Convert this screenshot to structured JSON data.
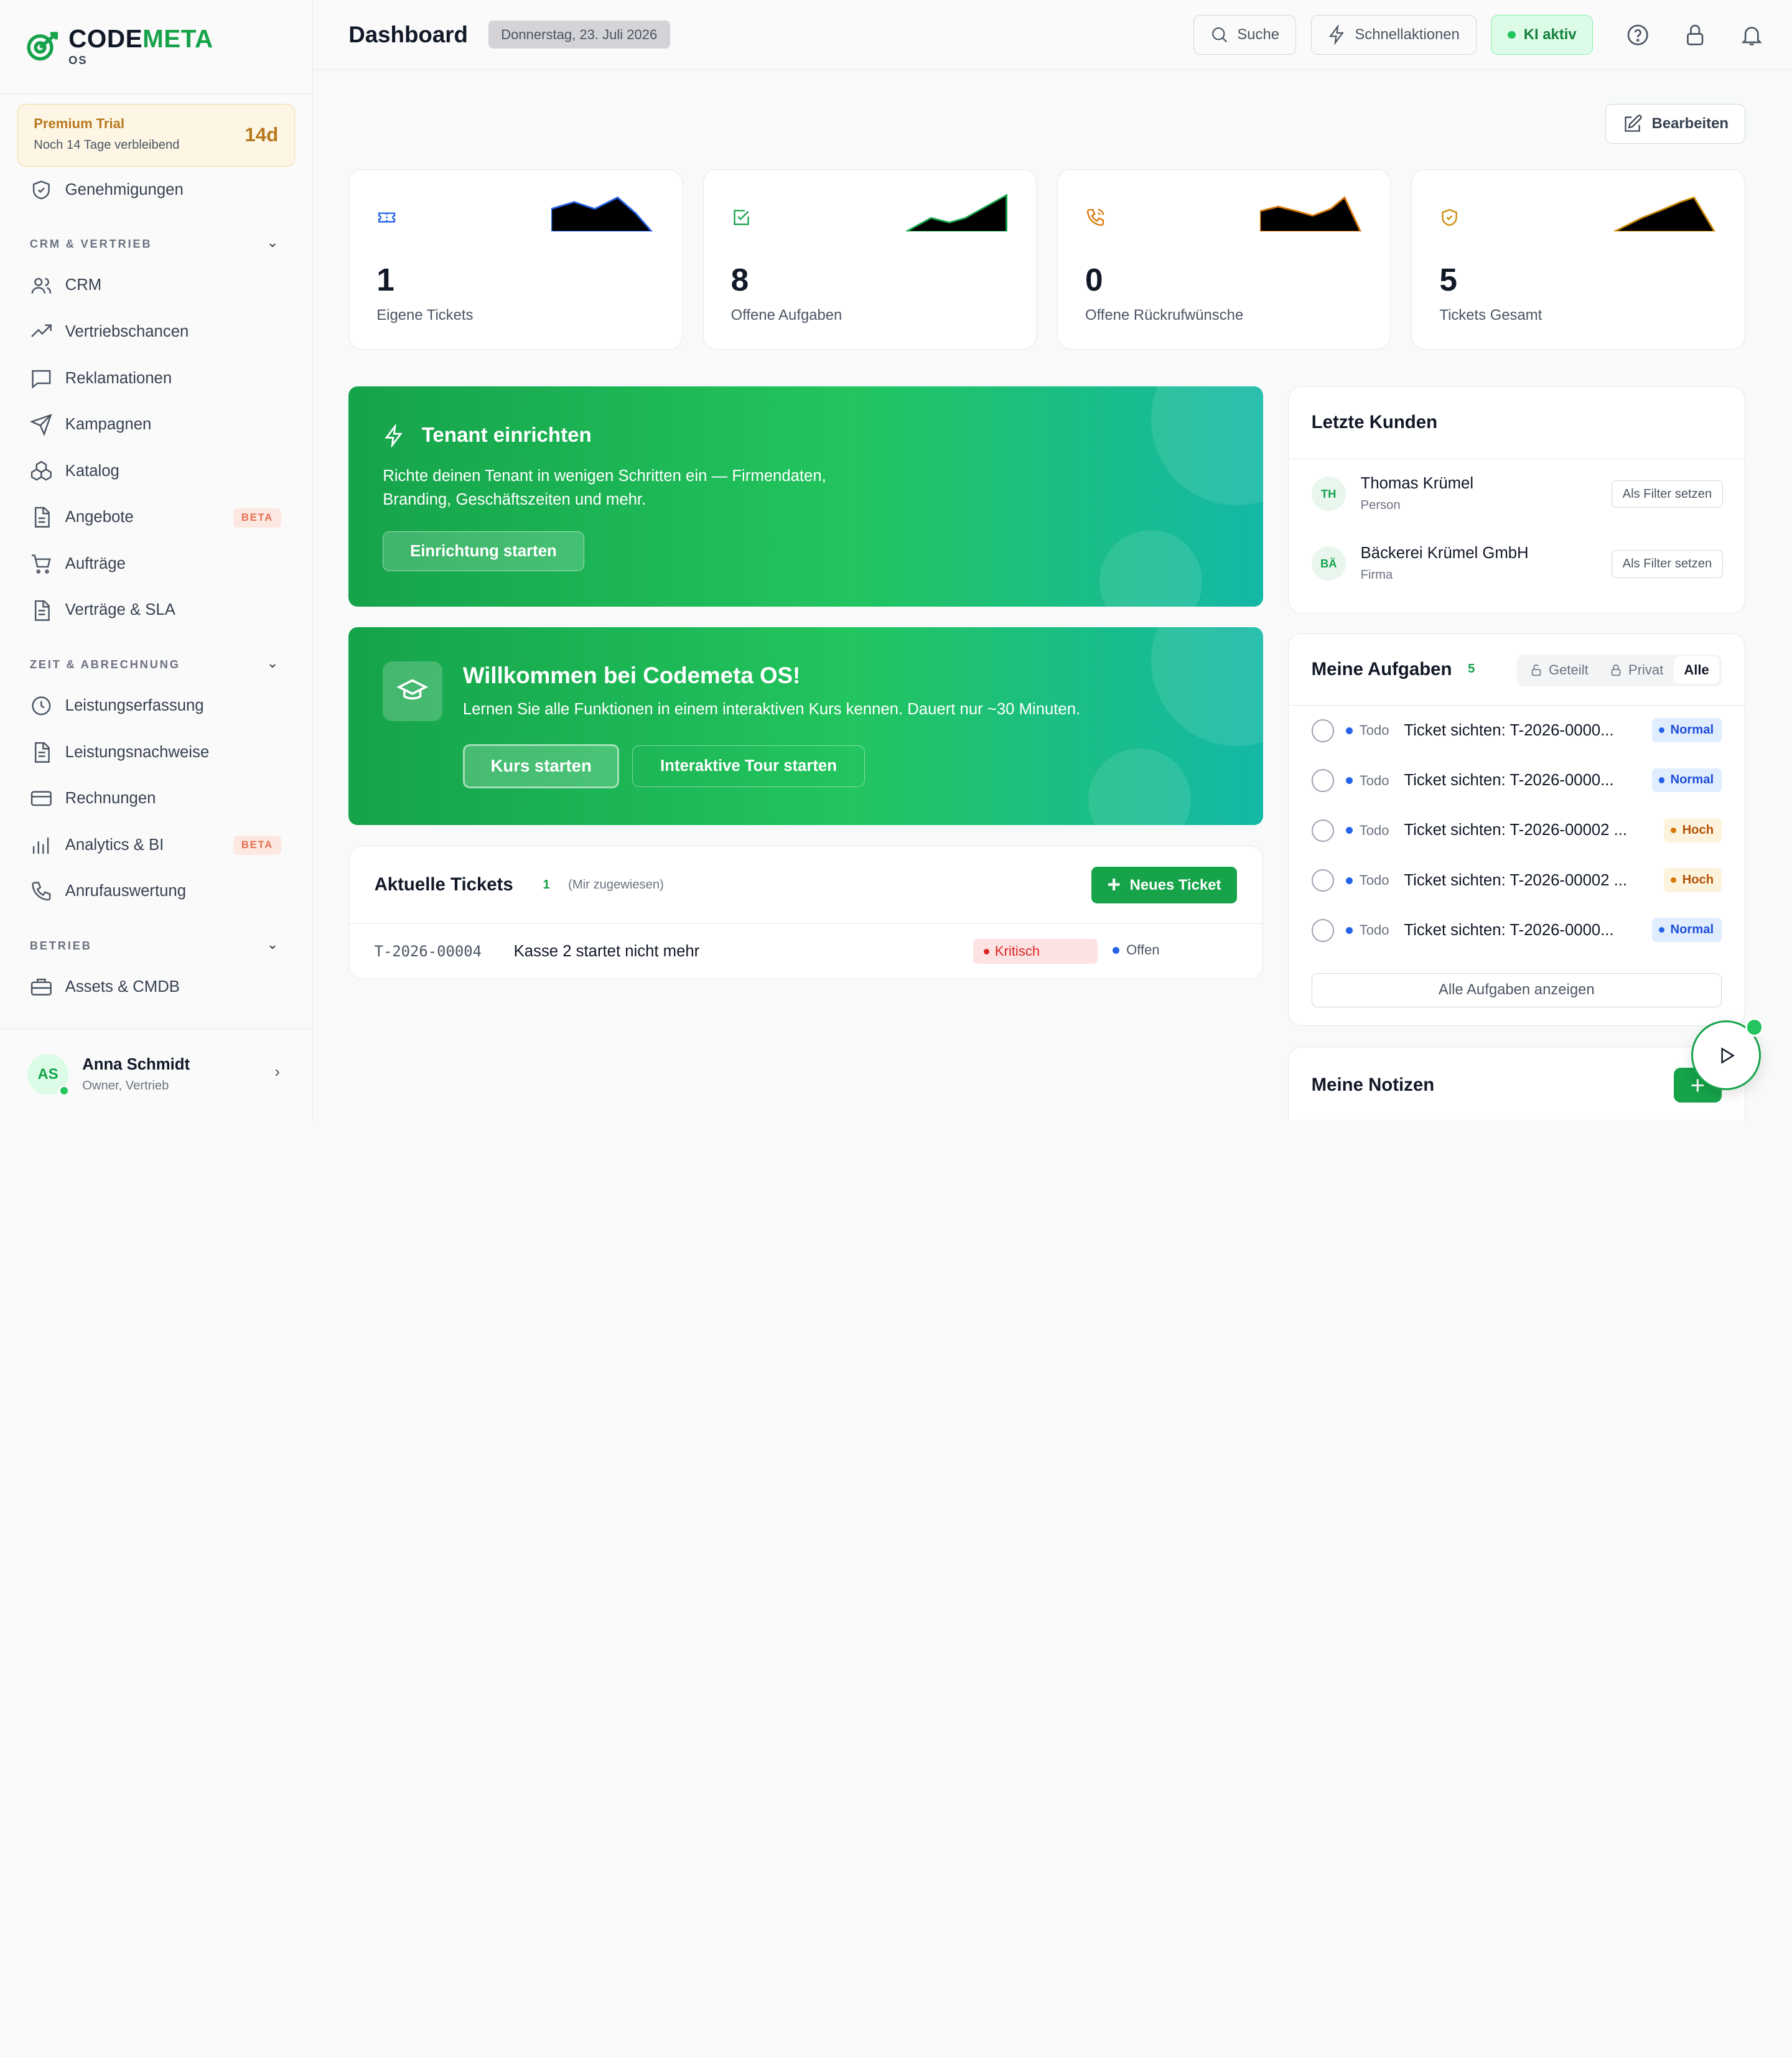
{
  "brand": {
    "name_part1": "CODE",
    "name_part2": "META",
    "sub": "OS"
  },
  "trial": {
    "title": "Premium Trial",
    "subtitle": "Noch 14 Tage verbleibend",
    "days": "14d"
  },
  "sidebar": {
    "top_item": "Genehmigungen",
    "sections": [
      {
        "label": "CRM & VERTRIEB",
        "items": [
          {
            "label": "CRM",
            "icon": "users-icon"
          },
          {
            "label": "Vertriebschancen",
            "icon": "trending-up-icon"
          },
          {
            "label": "Reklamationen",
            "icon": "message-icon"
          },
          {
            "label": "Kampagnen",
            "icon": "send-icon"
          },
          {
            "label": "Katalog",
            "icon": "boxes-icon"
          },
          {
            "label": "Angebote",
            "icon": "file-icon",
            "badge": "BETA"
          },
          {
            "label": "Aufträge",
            "icon": "cart-icon"
          },
          {
            "label": "Verträge & SLA",
            "icon": "file-text-icon"
          }
        ]
      },
      {
        "label": "ZEIT & ABRECHNUNG",
        "items": [
          {
            "label": "Leistungserfassung",
            "icon": "clock-icon"
          },
          {
            "label": "Leistungsnachweise",
            "icon": "file-text-icon"
          },
          {
            "label": "Rechnungen",
            "icon": "credit-card-icon"
          },
          {
            "label": "Analytics & BI",
            "icon": "bar-chart-icon",
            "badge": "BETA"
          },
          {
            "label": "Anrufauswertung",
            "icon": "phone-icon"
          }
        ]
      },
      {
        "label": "BETRIEB",
        "items": [
          {
            "label": "Assets & CMDB",
            "icon": "briefcase-icon"
          }
        ]
      }
    ]
  },
  "user": {
    "initials": "AS",
    "name": "Anna Schmidt",
    "role": "Owner, Vertrieb"
  },
  "header": {
    "title": "Dashboard",
    "date": "Donnerstag, 23. Juli 2026",
    "search": "Suche",
    "quick_actions": "Schnellaktionen",
    "ai_status": "KI aktiv",
    "edit": "Bearbeiten"
  },
  "kpis": [
    {
      "value": "1",
      "label": "Eigene Tickets",
      "color": "#2563eb",
      "icon": "ticket-icon"
    },
    {
      "value": "8",
      "label": "Offene Aufgaben",
      "color": "#16a34a",
      "icon": "check-square-icon"
    },
    {
      "value": "0",
      "label": "Offene Rückrufwünsche",
      "color": "#d97706",
      "icon": "phone-call-icon"
    },
    {
      "value": "5",
      "label": "Tickets Gesamt",
      "color": "#ca8a04",
      "icon": "shield-check-icon"
    }
  ],
  "setup_banner": {
    "title": "Tenant einrichten",
    "description": "Richte deinen Tenant in wenigen Schritten ein — Firmendaten, Branding, Geschäftszeiten und mehr.",
    "button": "Einrichtung starten"
  },
  "welcome_banner": {
    "title": "Willkommen bei Codemeta OS!",
    "description": "Lernen Sie alle Funktionen in einem interaktiven Kurs kennen. Dauert nur ~30 Minuten.",
    "primary_button": "Kurs starten",
    "secondary_button": "Interaktive Tour starten"
  },
  "tickets": {
    "title": "Aktuelle Tickets",
    "count": "1",
    "subtitle": "(Mir zugewiesen)",
    "new_button": "Neues Ticket",
    "rows": [
      {
        "id": "T-2026-00004",
        "title": "Kasse 2 startet nicht mehr",
        "priority": "Kritisch",
        "status": "Offen"
      }
    ]
  },
  "customers": {
    "title": "Letzte Kunden",
    "filter_label": "Als Filter setzen",
    "items": [
      {
        "initials": "TH",
        "name": "Thomas Krümel",
        "type": "Person"
      },
      {
        "initials": "BÄ",
        "name": "Bäckerei Krümel GmbH",
        "type": "Firma"
      }
    ]
  },
  "tasks": {
    "title": "Meine Aufgaben",
    "count": "5",
    "filters": [
      "Geteilt",
      "Privat",
      "Alle"
    ],
    "active_filter": "Alle",
    "items": [
      {
        "state": "Todo",
        "title": "Ticket sichten: T-2026-0000...",
        "priority": "Normal"
      },
      {
        "state": "Todo",
        "title": "Ticket sichten: T-2026-0000...",
        "priority": "Normal"
      },
      {
        "state": "Todo",
        "title": "Ticket sichten: T-2026-00002 ...",
        "priority": "Hoch"
      },
      {
        "state": "Todo",
        "title": "Ticket sichten: T-2026-00002 ...",
        "priority": "Hoch"
      },
      {
        "state": "Todo",
        "title": "Ticket sichten: T-2026-0000...",
        "priority": "Normal"
      }
    ],
    "show_all": "Alle Aufgaben anzeigen"
  },
  "notes": {
    "title": "Meine Notizen",
    "add": "+"
  }
}
